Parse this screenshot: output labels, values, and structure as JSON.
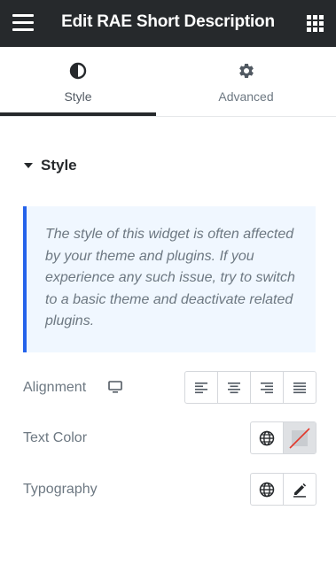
{
  "header": {
    "title": "Edit RAE Short Description",
    "menu_icon": "hamburger-menu-icon",
    "apps_icon": "grid-apps-icon"
  },
  "tabs": [
    {
      "label": "Style",
      "icon": "half-circle-icon",
      "active": true
    },
    {
      "label": "Advanced",
      "icon": "gear-icon",
      "active": false
    }
  ],
  "section": {
    "title": "Style",
    "expanded": true
  },
  "notice": {
    "text": "The style of this widget is often affected by your theme and plugins. If you experience any such issue, try to switch to a basic theme and deactivate related plugins."
  },
  "controls": {
    "alignment": {
      "label": "Alignment",
      "device_icon": "desktop-monitor-icon",
      "options": [
        "align-left",
        "align-center",
        "align-right",
        "align-justify"
      ]
    },
    "text_color": {
      "label": "Text Color",
      "global_icon": "globe-icon",
      "value": "none"
    },
    "typography": {
      "label": "Typography",
      "global_icon": "globe-icon",
      "edit_icon": "pencil-icon"
    }
  },
  "colors": {
    "header_bg": "#26292c",
    "notice_bg": "#f0f7ff",
    "notice_border": "#2563eb",
    "no_color_slash": "#e2382b"
  }
}
